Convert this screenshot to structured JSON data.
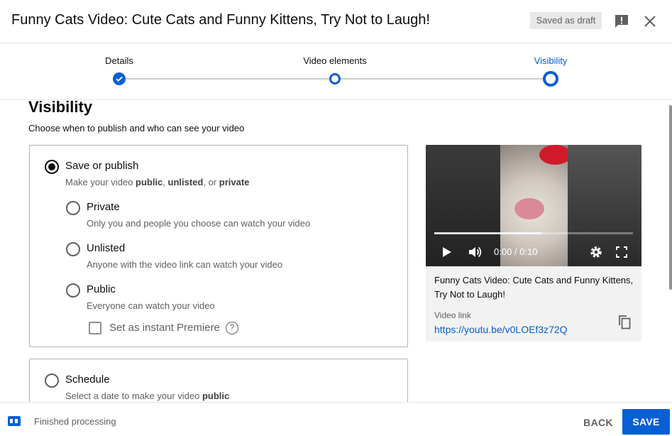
{
  "header": {
    "title": "Funny Cats Video: Cute Cats and Funny Kittens, Try Not to Laugh!",
    "draft_badge": "Saved as draft",
    "feedback_icon": "feedback-icon",
    "close_icon": "close-icon"
  },
  "stepper": {
    "steps": [
      {
        "label": "Details",
        "state": "done"
      },
      {
        "label": "Video elements",
        "state": "complete"
      },
      {
        "label": "Visibility",
        "state": "active"
      }
    ],
    "accent_color": "#065fd4"
  },
  "visibility": {
    "title": "Visibility",
    "subtitle": "Choose when to publish and who can see your video",
    "save_or_publish": {
      "label": "Save or publish",
      "selected": true,
      "desc_prefix": "Make your video ",
      "desc_public": "public",
      "desc_sep1": ", ",
      "desc_unlisted": "unlisted",
      "desc_sep2": ", or ",
      "desc_private": "private",
      "options": [
        {
          "label": "Private",
          "desc": "Only you and people you choose can watch your video",
          "selected": false
        },
        {
          "label": "Unlisted",
          "desc": "Anyone with the video link can watch your video",
          "selected": false
        },
        {
          "label": "Public",
          "desc": "Everyone can watch your video",
          "selected": false
        }
      ],
      "premiere_label": "Set as instant Premiere",
      "premiere_checked": false,
      "help_icon": "?"
    },
    "schedule": {
      "label": "Schedule",
      "selected": false,
      "desc_prefix": "Select a date to make your video ",
      "desc_bold": "public"
    }
  },
  "preview": {
    "time": "0:00 / 0:10",
    "progress": 0.54,
    "video_title": "Funny Cats Video: Cute Cats and Funny Kittens, Try Not to Laugh!",
    "link_label": "Video link",
    "link_url": "https://youtu.be/v0LOEf3z72Q"
  },
  "footer": {
    "status": "Finished processing",
    "back_label": "BACK",
    "save_label": "SAVE"
  }
}
